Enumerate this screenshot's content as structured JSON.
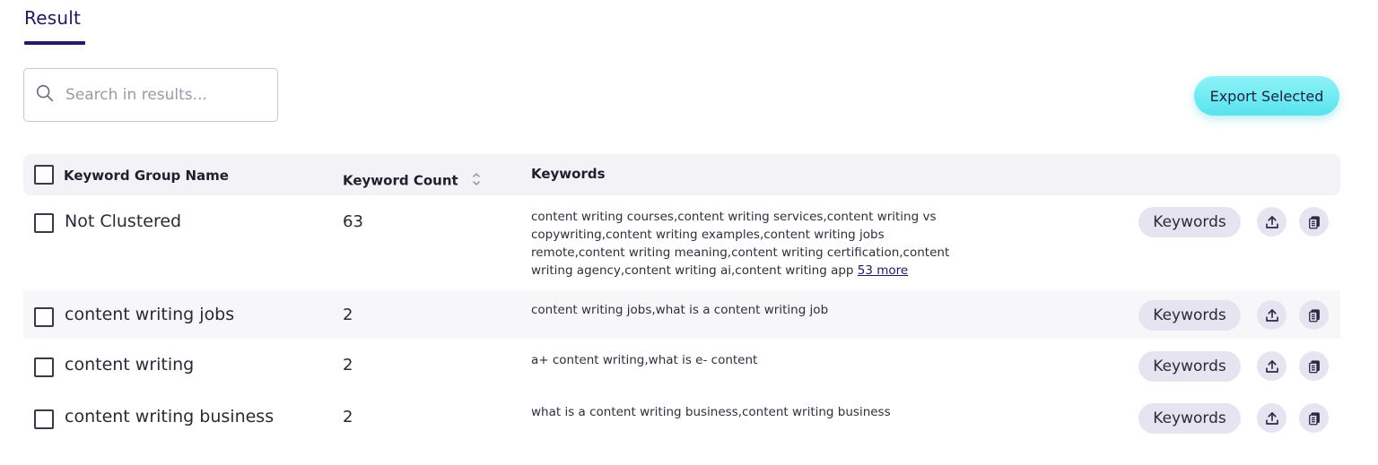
{
  "tab": {
    "label": "Result"
  },
  "search": {
    "placeholder": "Search in results..."
  },
  "toolbar": {
    "export_label": "Export Selected"
  },
  "table": {
    "headers": {
      "group_name": "Keyword Group Name",
      "count": "Keyword Count",
      "keywords": "Keywords"
    },
    "rows": [
      {
        "name": "Not Clustered",
        "count": "63",
        "keywords": "content writing courses,content writing services,content writing vs copywriting,content writing examples,content writing jobs remote,content writing meaning,content writing certification,content writing agency,content writing ai,content writing app",
        "more": "53 more",
        "button": "Keywords"
      },
      {
        "name": "content writing jobs",
        "count": "2",
        "keywords": "content writing jobs,what is a content writing job",
        "button": "Keywords"
      },
      {
        "name": "content writing",
        "count": "2",
        "keywords": "a+ content writing,what is e- content",
        "button": "Keywords"
      },
      {
        "name": "content writing business",
        "count": "2",
        "keywords": "what is a content writing business,content writing business",
        "button": "Keywords"
      }
    ]
  },
  "colors": {
    "accent": "#231b63",
    "export_bg": "#57e3ee",
    "pill_bg": "#e6e4f0"
  },
  "icons": [
    "search-icon",
    "sort-icon",
    "upload-icon",
    "copy-icon"
  ]
}
